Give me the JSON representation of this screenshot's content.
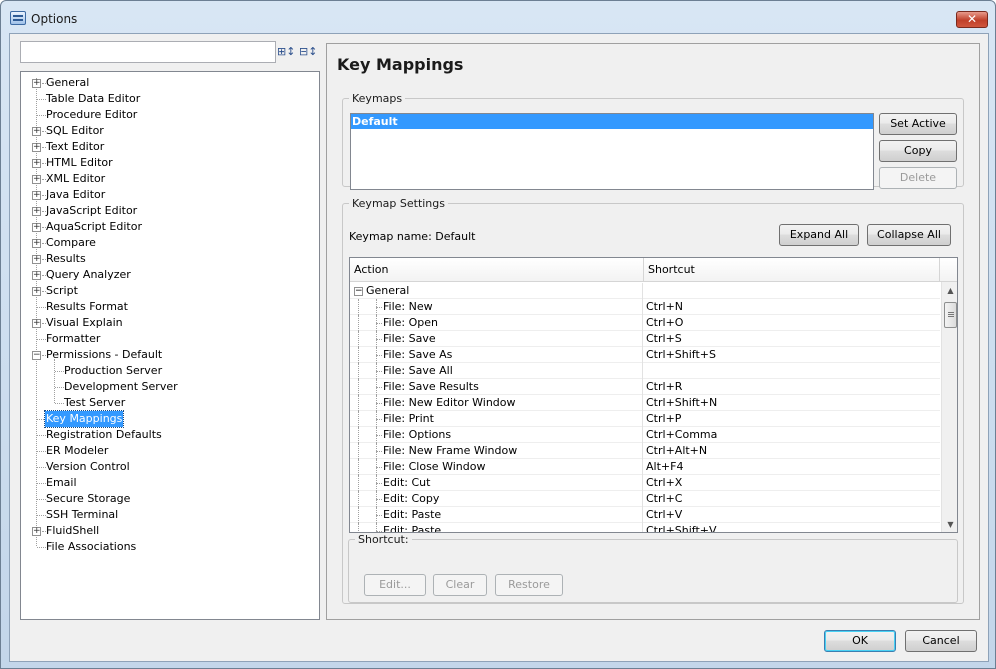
{
  "window": {
    "title": "Options",
    "close_glyph": "✕"
  },
  "search": {
    "value": "",
    "placeholder": ""
  },
  "toolbar": {
    "expand_icon": "expand-all-icon",
    "collapse_icon": "collapse-all-icon"
  },
  "tree": {
    "items": [
      {
        "label": "General",
        "expandable": true,
        "level": 0
      },
      {
        "label": "Table Data Editor",
        "expandable": false,
        "level": 0
      },
      {
        "label": "Procedure Editor",
        "expandable": false,
        "level": 0
      },
      {
        "label": "SQL Editor",
        "expandable": true,
        "level": 0
      },
      {
        "label": "Text Editor",
        "expandable": true,
        "level": 0
      },
      {
        "label": "HTML Editor",
        "expandable": true,
        "level": 0
      },
      {
        "label": "XML Editor",
        "expandable": true,
        "level": 0
      },
      {
        "label": "Java Editor",
        "expandable": true,
        "level": 0
      },
      {
        "label": "JavaScript Editor",
        "expandable": true,
        "level": 0
      },
      {
        "label": "AquaScript Editor",
        "expandable": true,
        "level": 0
      },
      {
        "label": "Compare",
        "expandable": true,
        "level": 0
      },
      {
        "label": "Results",
        "expandable": true,
        "level": 0
      },
      {
        "label": "Query Analyzer",
        "expandable": true,
        "level": 0
      },
      {
        "label": "Script",
        "expandable": true,
        "level": 0
      },
      {
        "label": "Results Format",
        "expandable": false,
        "level": 0
      },
      {
        "label": "Visual Explain",
        "expandable": true,
        "level": 0
      },
      {
        "label": "Formatter",
        "expandable": false,
        "level": 0
      },
      {
        "label": "Permissions - Default",
        "expandable": true,
        "expanded": true,
        "level": 0
      },
      {
        "label": "Production Server",
        "expandable": false,
        "level": 1
      },
      {
        "label": "Development Server",
        "expandable": false,
        "level": 1
      },
      {
        "label": "Test Server",
        "expandable": false,
        "level": 1
      },
      {
        "label": "Key Mappings",
        "expandable": false,
        "level": 0,
        "selected": true
      },
      {
        "label": "Registration Defaults",
        "expandable": false,
        "level": 0
      },
      {
        "label": "ER Modeler",
        "expandable": false,
        "level": 0
      },
      {
        "label": "Version Control",
        "expandable": false,
        "level": 0
      },
      {
        "label": "Email",
        "expandable": false,
        "level": 0
      },
      {
        "label": "Secure Storage",
        "expandable": false,
        "level": 0
      },
      {
        "label": "SSH Terminal",
        "expandable": false,
        "level": 0
      },
      {
        "label": "FluidShell",
        "expandable": true,
        "level": 0
      },
      {
        "label": "File Associations",
        "expandable": false,
        "level": 0
      }
    ]
  },
  "page": {
    "title": "Key Mappings"
  },
  "keymaps": {
    "legend": "Keymaps",
    "items": [
      {
        "label": "Default",
        "selected": true
      }
    ],
    "buttons": {
      "set_active": "Set Active",
      "copy": "Copy",
      "delete": "Delete"
    }
  },
  "settings": {
    "legend": "Keymap Settings",
    "keymap_name": "Keymap name: Default",
    "expand_all": "Expand All",
    "collapse_all": "Collapse All",
    "columns": {
      "action": "Action",
      "shortcut": "Shortcut"
    },
    "group": "General",
    "rows": [
      {
        "action": "File: New",
        "shortcut": "Ctrl+N"
      },
      {
        "action": "File: Open",
        "shortcut": "Ctrl+O"
      },
      {
        "action": "File: Save",
        "shortcut": "Ctrl+S"
      },
      {
        "action": "File: Save As",
        "shortcut": "Ctrl+Shift+S"
      },
      {
        "action": "File: Save All",
        "shortcut": ""
      },
      {
        "action": "File: Save Results",
        "shortcut": "Ctrl+R"
      },
      {
        "action": "File: New Editor Window",
        "shortcut": "Ctrl+Shift+N"
      },
      {
        "action": "File: Print",
        "shortcut": "Ctrl+P"
      },
      {
        "action": "File: Options",
        "shortcut": "Ctrl+Comma"
      },
      {
        "action": "File: New Frame Window",
        "shortcut": "Ctrl+Alt+N"
      },
      {
        "action": "File: Close Window",
        "shortcut": "Alt+F4"
      },
      {
        "action": "Edit: Cut",
        "shortcut": "Ctrl+X"
      },
      {
        "action": "Edit: Copy",
        "shortcut": "Ctrl+C"
      },
      {
        "action": "Edit: Paste",
        "shortcut": "Ctrl+V"
      },
      {
        "action": "Edit: Paste",
        "shortcut": "Ctrl+Shift+V"
      }
    ]
  },
  "shortcut": {
    "legend": "Shortcut:",
    "edit": "Edit...",
    "clear": "Clear",
    "restore": "Restore"
  },
  "footer": {
    "ok": "OK",
    "cancel": "Cancel"
  }
}
